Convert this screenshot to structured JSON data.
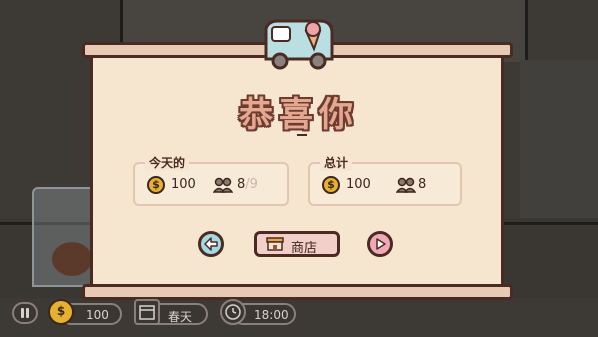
{
  "popup": {
    "title": "恭喜你",
    "today": {
      "label": "今天的",
      "coins": "100",
      "customers_served": "8",
      "customers_total": "/9"
    },
    "total": {
      "label": "总计",
      "coins": "100",
      "customers": "8"
    },
    "buttons": {
      "back_icon": "left-arrow-icon",
      "shop_label": "商店",
      "shop_icon": "storefront-icon",
      "next_icon": "right-arrow-icon"
    }
  },
  "hud": {
    "pause_icon": "pause-icon",
    "money": "100",
    "season": "春天",
    "time": "18:00"
  },
  "colors": {
    "paper": "#f6e6cf",
    "title": "#e4a791",
    "outline": "#4a2b24",
    "coin": "#e7b02e",
    "back_button": "#a6d8e2",
    "next_button": "#f2a9b7",
    "shop_button": "#f3cfc9"
  }
}
